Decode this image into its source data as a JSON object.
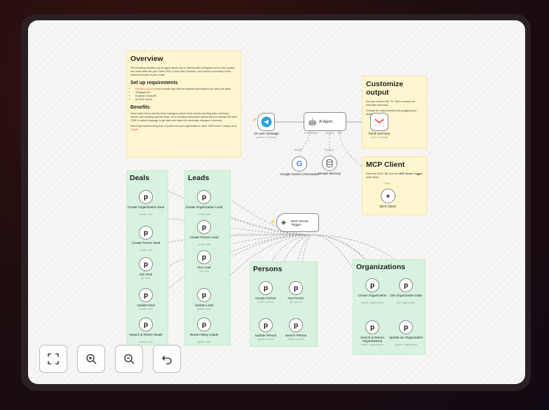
{
  "overview": {
    "title": "Overview",
    "intro": "The following workflow and AI agent allows you to interact with a telegram bot to read, update, and insert data into your Sales CRM, in this case Pipedrive, and receive a summary of the actions executed in your email.",
    "setup_title": "Set up requirements",
    "req_link": "Pipedrive account",
    "req_rest": " and a private app with the required permissions you wish you grant",
    "req2": "Telegram bot",
    "req3": "Enabled Gmail API",
    "req4": "An MCP server",
    "benefits_title": "Benefits",
    "benefits_text": "Some sales teams and top level managers spend hours weekly inserting data, retrieving results, and updating specific fields. Such workflow automation allows them to interact with their CRM in natural language to get data and make the necessary changes in seconds.",
    "contact_text": "Need help implementing such a system for your organization in other CRM tools? Contact us at ",
    "contact_link": "1Node"
  },
  "customize": {
    "title": "Customize output",
    "p1": "Set your email in the \"To\" field to receive the execution summary.",
    "p2": "Change the output workflow by plugging your desired tools."
  },
  "mcp_client_note": {
    "title": "MCP Client",
    "text_a": "Paste the MCP URL from the ",
    "text_b": "MCP Server Trigger",
    "text_c": " node below",
    "tools_tag": "Tools",
    "node_label": "MCP Client"
  },
  "flow": {
    "telegram_label": "On new message",
    "telegram_sub": "updates: message",
    "agent_label": "AI Agent",
    "chat_model_tag": "Chat Model*",
    "memory_tag": "Memory",
    "tool_tag": "Tool",
    "gmail_label": "Send summary",
    "gmail_sub": "send: message",
    "gemini_tag": "Model",
    "gemini_label": "Google Gemini Chat Model",
    "memory_node_tag": "Memory",
    "memory_label": "Simple Memory",
    "mcp_trigger_label": "MCP Server Trigger"
  },
  "groups": {
    "deals": {
      "title": "Deals",
      "nodes": [
        {
          "label": "Create Organization Deal",
          "sub": "create: deal"
        },
        {
          "label": "Create Person Deal",
          "sub": "create: deal"
        },
        {
          "label": "Get Deal",
          "sub": "get: deal"
        },
        {
          "label": "Update Deal",
          "sub": "update: deal"
        },
        {
          "label": "Search & Return Deals",
          "sub": "search: deal"
        }
      ]
    },
    "leads": {
      "title": "Leads",
      "nodes": [
        {
          "label": "Create Organization Lead",
          "sub": "create: lead"
        },
        {
          "label": "Create Person Lead",
          "sub": "create: lead"
        },
        {
          "label": "Get Lead",
          "sub": "get: lead"
        },
        {
          "label": "Update Lead",
          "sub": "update: lead"
        },
        {
          "label": "Return Many Leads",
          "sub": "getAll: lead"
        }
      ]
    },
    "persons": {
      "title": "Persons",
      "nodes": [
        {
          "label": "Create Person",
          "sub": "create: person"
        },
        {
          "label": "Get Person",
          "sub": "get: person"
        },
        {
          "label": "Update Person",
          "sub": "update: person"
        },
        {
          "label": "Search Person",
          "sub": "search: person"
        }
      ]
    },
    "organizations": {
      "title": "Organizations",
      "nodes": [
        {
          "label": "Create Organization",
          "sub": "create: organization"
        },
        {
          "label": "Get Organization Data",
          "sub": "get: organization"
        },
        {
          "label": "Search & Return Organizations",
          "sub": "search: organization"
        },
        {
          "label": "Update an Organization",
          "sub": "update: organization"
        }
      ]
    }
  },
  "controls": [
    {
      "name": "fit-view-button",
      "icon": "fit-view-icon"
    },
    {
      "name": "zoom-in-button",
      "icon": "zoom-in-icon"
    },
    {
      "name": "zoom-out-button",
      "icon": "zoom-out-icon"
    },
    {
      "name": "undo-button",
      "icon": "undo-icon"
    }
  ],
  "colors": {
    "accent": "#e8553d",
    "sticky_yellow": "#fff6cf",
    "sticky_green": "#d7f3df",
    "telegram": "#2aa3df"
  }
}
